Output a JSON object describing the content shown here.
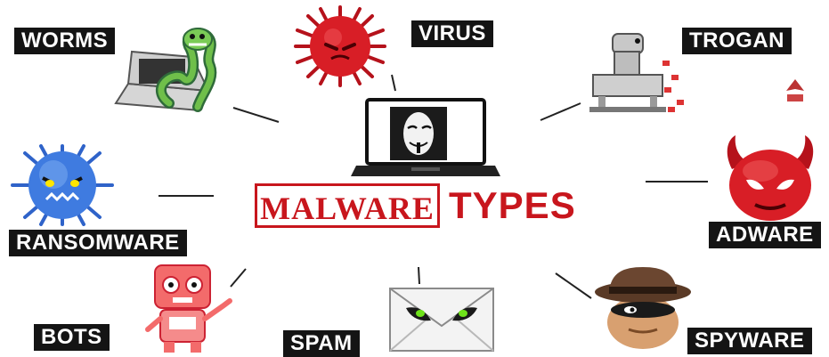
{
  "title": {
    "part1": "MALWARE",
    "part2": "TYPES"
  },
  "labels": {
    "worms": "WORMS",
    "virus": "VIRUS",
    "trojan": "TROGAN",
    "ransomware": "RANSOMWARE",
    "adware": "ADWARE",
    "bots": "BOTS",
    "spam": "SPAM",
    "spyware": "SPYWARE"
  },
  "colors": {
    "accent": "#c8161d",
    "label_bg": "#141414",
    "label_text": "#ffffff"
  },
  "icons": [
    "worm-laptop-icon",
    "virus-icon",
    "trojan-horse-icon",
    "ransomware-monster-icon",
    "adware-devil-icon",
    "bot-robot-icon",
    "spam-envelope-icon",
    "spyware-spy-icon",
    "hacker-laptop-icon"
  ]
}
